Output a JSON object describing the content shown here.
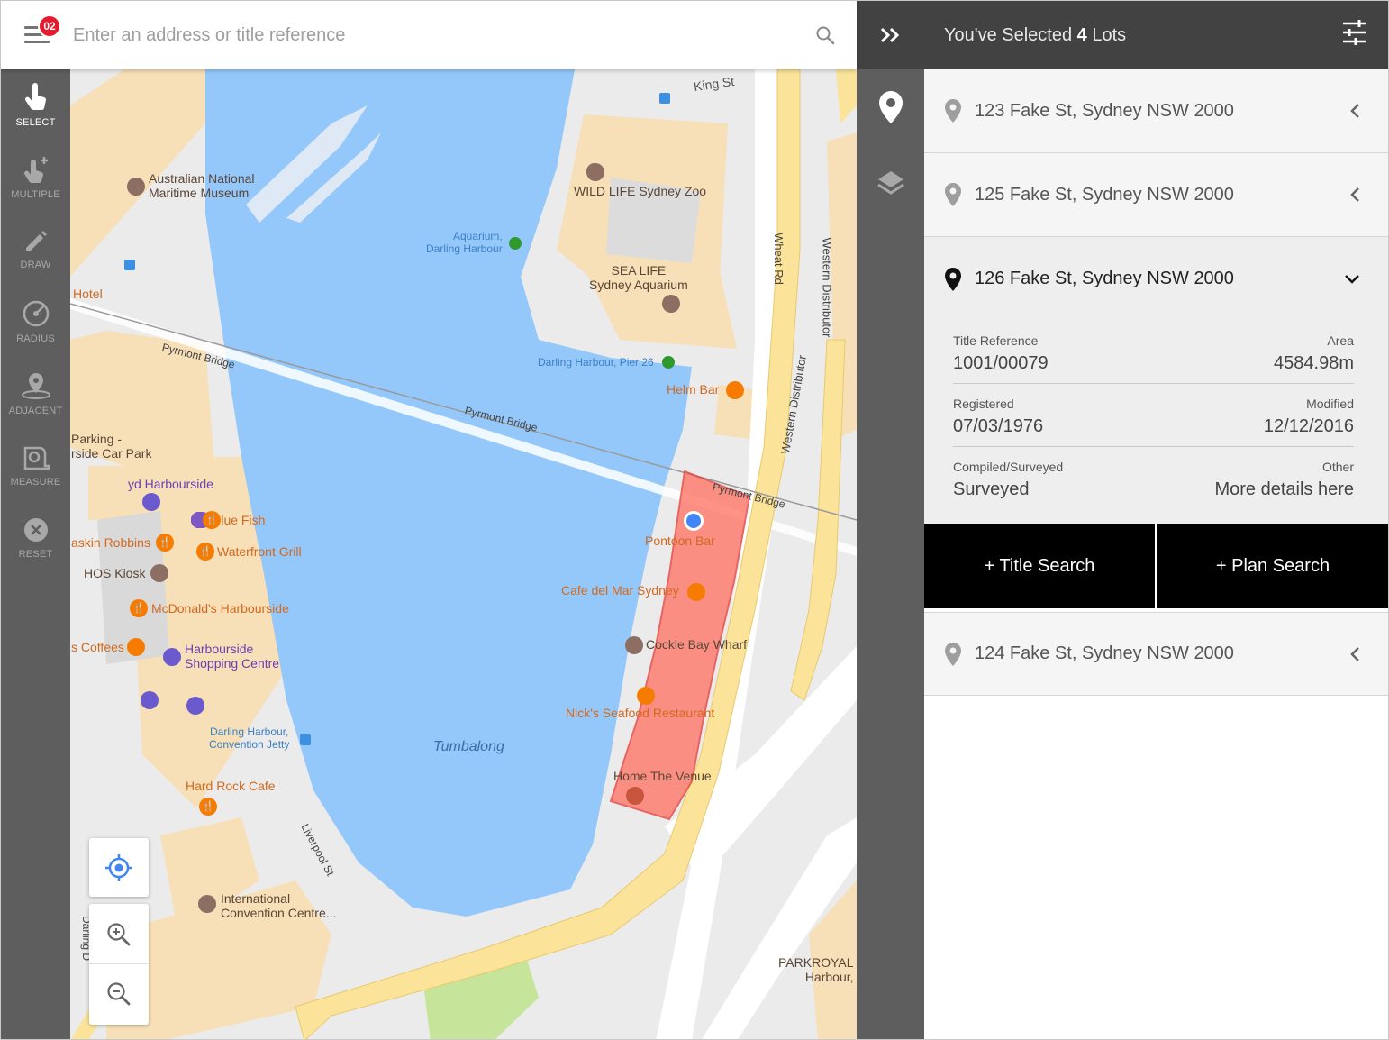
{
  "search": {
    "placeholder": "Enter an address or title reference",
    "notification_count": "02"
  },
  "tools": [
    {
      "label": "SELECT",
      "icon": "hand-pointer-icon",
      "active": true
    },
    {
      "label": "MULTIPLE",
      "icon": "multi-touch-icon",
      "active": false
    },
    {
      "label": "DRAW",
      "icon": "pencil-icon",
      "active": false
    },
    {
      "label": "RADIUS",
      "icon": "radius-icon",
      "active": false
    },
    {
      "label": "ADJACENT",
      "icon": "adjacent-pin-icon",
      "active": false
    },
    {
      "label": "MEASURE",
      "icon": "measure-tape-icon",
      "active": false
    },
    {
      "label": "RESET",
      "icon": "close-circle-icon",
      "active": false
    }
  ],
  "map": {
    "labels": {
      "king_st": "King St",
      "anmm": "Australian National\nMaritime Museum",
      "wildlife": "WILD LIFE Sydney Zoo",
      "aquarium_stop": "Aquarium,\nDarling Harbour",
      "sea_life": "SEA LIFE\nSydney Aquarium",
      "hotel": "Hotel",
      "pyrmont_bridge_1": "Pyrmont Bridge",
      "pyrmont_bridge_2": "Pyrmont Bridge",
      "pyrmont_bridge_3": "Pyrmont Bridge",
      "pier26": "Darling Harbour, Pier 26",
      "helm_bar": "Helm Bar",
      "car_park": "Parking -\nrside Car Park",
      "harbourside": "yd Harbourside",
      "blue_fish": "Blue Fish",
      "askin": "askin Robbins",
      "waterfront": "Waterfront Grill",
      "hos_kiosk": "HOS Kiosk",
      "mcdonalds": "McDonald's Harbourside",
      "coffees": "s Coffees",
      "shopping": "Harbourside\nShopping Centre",
      "convention_jetty": "Darling Harbour,\nConvention Jetty",
      "tumbalong": "Tumbalong",
      "hard_rock": "Hard Rock Cafe",
      "liverpool": "Liverpool St",
      "icc": "International\nConvention Centre...",
      "darling": "Darling D",
      "pontoon": "Pontoon Bar",
      "cafe_del_mar": "Cafe del Mar Sydney",
      "cockle_bay": "Cockle Bay Wharf",
      "nicks": "Nick's Seafood Restaurant",
      "home_venue": "Home The Venue",
      "wheat_rd": "Wheat Rd",
      "western_dist_1": "Western Distributor",
      "western_dist_2": "Western Distributor",
      "parkroyal": "PARKROYAL\nHarbour,"
    }
  },
  "panel": {
    "header_prefix": "You've Selected",
    "selected_count": "4",
    "header_suffix": "Lots",
    "lots": [
      {
        "address": "123 Fake St, Sydney NSW 2000"
      },
      {
        "address": "125 Fake St, Sydney NSW 2000"
      }
    ],
    "expanded_lot": {
      "address": "126 Fake St, Sydney NSW 2000",
      "title_reference_label": "Title Reference",
      "title_reference": "1001/00079",
      "area_label": "Area",
      "area": "4584.98m",
      "registered_label": "Registered",
      "registered": "07/03/1976",
      "modified_label": "Modified",
      "modified": "12/12/2016",
      "compiled_label": "Compiled/Surveyed",
      "compiled": "Surveyed",
      "other_label": "Other",
      "other": "More details here"
    },
    "title_search_label": "+ Title Search",
    "plan_search_label": "+ Plan Search",
    "last_lot": {
      "address": "124 Fake St, Sydney NSW 2000"
    }
  }
}
